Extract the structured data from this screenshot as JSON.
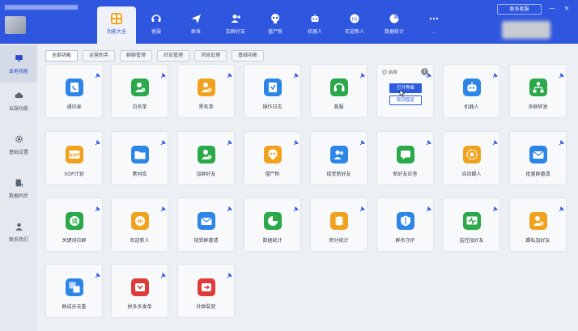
{
  "header": {
    "contact_button": "联系客服",
    "minimize": "—",
    "close": "✕",
    "nav": [
      {
        "label": "功能大全",
        "icon": "grid-icon",
        "active": true
      },
      {
        "label": "客服",
        "icon": "headset-icon"
      },
      {
        "label": "群发",
        "icon": "send-icon"
      },
      {
        "label": "加群好友",
        "icon": "add-user-icon"
      },
      {
        "label": "僵尸粉",
        "icon": "skull-icon"
      },
      {
        "label": "机器人",
        "icon": "robot-icon"
      },
      {
        "label": "欢迎新人",
        "icon": "welcome-icon"
      },
      {
        "label": "数据统计",
        "icon": "pie-chart-icon"
      },
      {
        "label": "...",
        "icon": "more-icon"
      }
    ]
  },
  "sidebar": {
    "items": [
      {
        "label": "本地功能",
        "icon": "monitor-icon",
        "active": true
      },
      {
        "label": "云端功能",
        "icon": "cloud-icon"
      },
      {
        "label": "基础设置",
        "icon": "gear-icon"
      },
      {
        "label": "数据同步",
        "icon": "sync-icon"
      },
      {
        "label": "联系我们",
        "icon": "person-icon"
      }
    ]
  },
  "tabs": [
    "全部功能",
    "运营助手",
    "群聊管理",
    "好友管理",
    "消息处理",
    "基础功能"
  ],
  "popup": {
    "startup": "启用",
    "help": "?",
    "open": "打开界面",
    "cancel": "取消固定"
  },
  "cards": [
    {
      "label": "通讯录",
      "icon": "phone-book-icon",
      "color": "#2d86e6"
    },
    {
      "label": "白名单",
      "icon": "user-check-icon",
      "color": "#2aa84a"
    },
    {
      "label": "黑名单",
      "icon": "user-block-icon",
      "color": "#f0a21e"
    },
    {
      "label": "操作日志",
      "icon": "log-icon",
      "color": "#2d86e6"
    },
    {
      "label": "客服",
      "icon": "headset-icon",
      "color": "#2aa84a"
    },
    {
      "label": "",
      "icon": "",
      "color": ""
    },
    {
      "label": "机器人",
      "icon": "robot-icon",
      "color": "#2d86e6"
    },
    {
      "label": "多群转发",
      "icon": "network-icon",
      "color": "#2aa84a"
    },
    {
      "label": "SOP计划",
      "icon": "sop-icon",
      "color": "#f0a21e"
    },
    {
      "label": "素材库",
      "icon": "folder-icon",
      "color": "#2d86e6"
    },
    {
      "label": "加群好友",
      "icon": "add-user-icon",
      "color": "#2aa84a"
    },
    {
      "label": "僵尸粉",
      "icon": "skull-icon",
      "color": "#f0a21e"
    },
    {
      "label": "接受新好友",
      "icon": "users-icon",
      "color": "#2d86e6"
    },
    {
      "label": "新好友应答",
      "icon": "chat-reply-icon",
      "color": "#2aa84a"
    },
    {
      "label": "自动踢人",
      "icon": "kick-icon",
      "color": "#f0a21e"
    },
    {
      "label": "批量群邀请",
      "icon": "mail-icon",
      "color": "#2d86e6"
    },
    {
      "label": "关键词拉群",
      "icon": "keyword-icon",
      "color": "#2aa84a"
    },
    {
      "label": "欢迎新人",
      "icon": "hi-icon",
      "color": "#f0a21e"
    },
    {
      "label": "接受群邀请",
      "icon": "envelope-icon",
      "color": "#2d86e6"
    },
    {
      "label": "数据统计",
      "icon": "pie-chart-icon",
      "color": "#2aa84a"
    },
    {
      "label": "积分统计",
      "icon": "coins-icon",
      "color": "#f0a21e"
    },
    {
      "label": "群名守护",
      "icon": "shield-icon",
      "color": "#2d86e6"
    },
    {
      "label": "监控加好友",
      "icon": "monitor-wave-icon",
      "color": "#2aa84a"
    },
    {
      "label": "踢私加好友",
      "icon": "user-remove-icon",
      "color": "#f0a21e"
    },
    {
      "label": "群成员去重",
      "icon": "dedupe-icon",
      "color": "#2d86e6"
    },
    {
      "label": "拼多多发单",
      "icon": "pdd-icon",
      "color": "#e03b3b"
    },
    {
      "label": "社群裂变",
      "icon": "fission-icon",
      "color": "#e03b3b"
    }
  ]
}
